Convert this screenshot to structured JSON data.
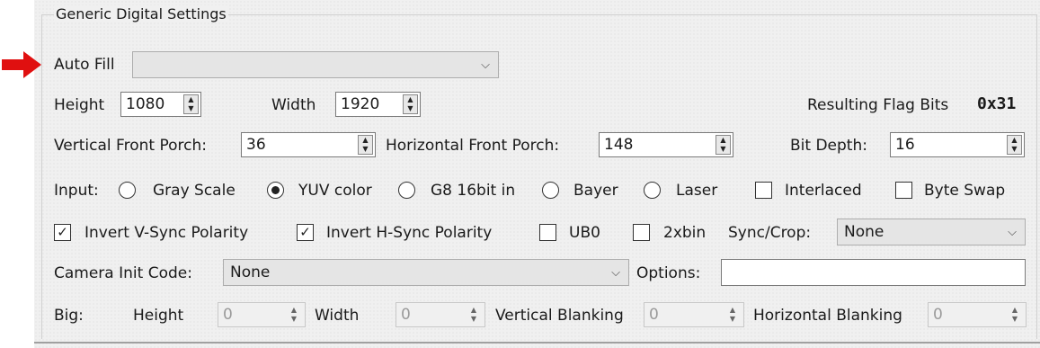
{
  "group_title": "Generic Digital Settings",
  "auto_fill": {
    "label": "Auto Fill",
    "value": ""
  },
  "height": {
    "label": "Height",
    "value": "1080"
  },
  "width": {
    "label": "Width",
    "value": "1920"
  },
  "flag_bits": {
    "label": "Resulting Flag Bits",
    "value": "0x31"
  },
  "vertical_front_porch": {
    "label": "Vertical Front Porch:",
    "value": "36"
  },
  "horizontal_front_porch": {
    "label": "Horizontal Front Porch:",
    "value": "148"
  },
  "bit_depth": {
    "label": "Bit Depth:",
    "value": "16"
  },
  "input": {
    "label": "Input:",
    "options": [
      {
        "label": "Gray Scale",
        "checked": false
      },
      {
        "label": "YUV color",
        "checked": true
      },
      {
        "label": "G8 16bit in",
        "checked": false
      },
      {
        "label": "Bayer",
        "checked": false
      },
      {
        "label": "Laser",
        "checked": false
      }
    ]
  },
  "interlaced": {
    "label": "Interlaced",
    "checked": false
  },
  "byte_swap": {
    "label": "Byte Swap",
    "checked": false
  },
  "invert_vsync": {
    "label": "Invert V-Sync Polarity",
    "checked": true
  },
  "invert_hsync": {
    "label": "Invert H-Sync Polarity",
    "checked": true
  },
  "ub0": {
    "label": "UB0",
    "checked": false
  },
  "xbin": {
    "label": "2xbin",
    "checked": false
  },
  "sync_crop": {
    "label": "Sync/Crop:",
    "value": "None"
  },
  "camera_init": {
    "label": "Camera Init Code:",
    "value": "None"
  },
  "options": {
    "label": "Options:",
    "value": ""
  },
  "big": {
    "label": "Big:",
    "height": {
      "label": "Height",
      "value": "0"
    },
    "width": {
      "label": "Width",
      "value": "0"
    },
    "vertical_blanking": {
      "label": "Vertical Blanking",
      "value": "0"
    },
    "horizontal_blanking": {
      "label": "Horizontal Blanking",
      "value": "0"
    }
  },
  "colors": {
    "pointer_arrow": "#e01010",
    "panel_bg": "#f0f0f0"
  },
  "icons": {
    "pointer": "red-arrow-icon",
    "dropdown": "chevron-down-icon",
    "spinner": "spin-arrows-icon"
  }
}
